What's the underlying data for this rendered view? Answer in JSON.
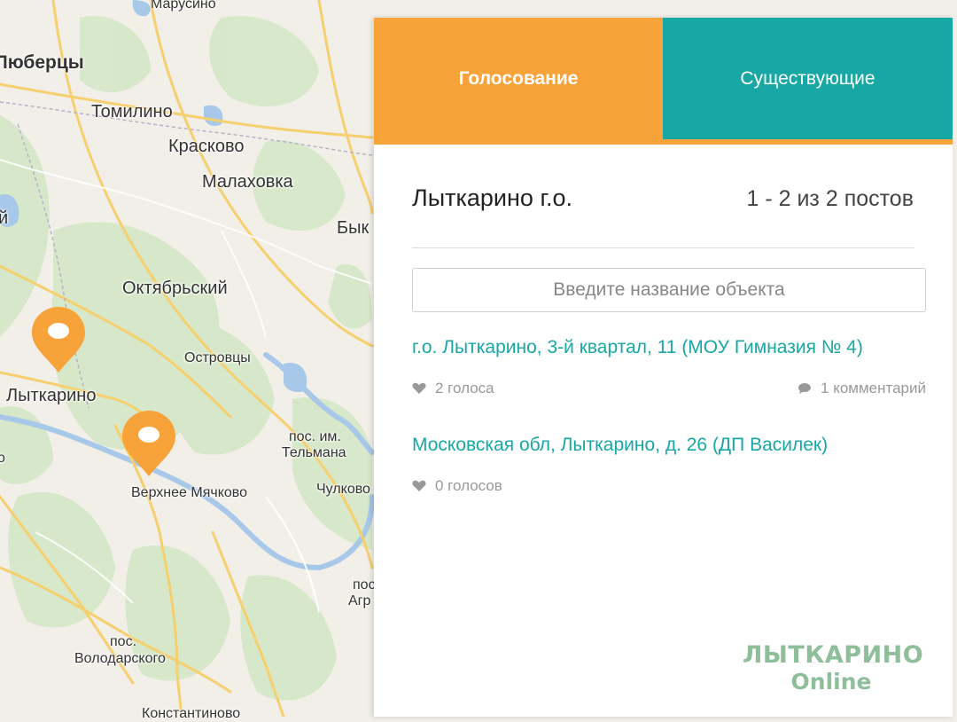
{
  "map": {
    "labels": {
      "lyubertsy": "Люберцы",
      "marusino": "Марусино",
      "tomilino": "Томилино",
      "kraskovo": "Красково",
      "malakhovka": "Малаховка",
      "byk": "Бык",
      "oktyabrsky": "Октябрьский",
      "ostrovtsy": "Островцы",
      "lytkarino": "Лыткарино",
      "pos_telmana_1": "пос. им.",
      "pos_telmana_2": "Тельмана",
      "chulkovo": "Чулково",
      "verkhnee_myachkovo": "Верхнее Мячково",
      "pos_agr_1": "пос",
      "pos_agr_2": "Агр",
      "pos_volodarskogo_1": "пос.",
      "pos_volodarskogo_2": "Володарского",
      "konstantinovo": "Константиново",
      "edge_o": "о",
      "edge_y": "й"
    },
    "pin_color": "#f8a23a",
    "pin_icon": "map-marker-icon"
  },
  "tabs": [
    {
      "label": "Голосование",
      "active": true,
      "color": "#f8a23a"
    },
    {
      "label": "Существующие",
      "active": false,
      "color": "#17a8a6"
    }
  ],
  "panel": {
    "title": "Лыткарино г.о.",
    "count": "1 - 2 из 2 постов",
    "search_placeholder": "Введите название объекта"
  },
  "posts": [
    {
      "title": "г.о. Лыткарино, 3-й квартал, 11 (МОУ Гимназия № 4)",
      "votes": "2 голоса",
      "comments": "1 комментарий"
    },
    {
      "title": "Московская обл, Лыткарино, д. 26 (ДП Василек)",
      "votes": "0 голосов"
    }
  ],
  "logo": {
    "line1": "ЛЫТКАРИНО",
    "line2": "Online"
  },
  "colors": {
    "accent_orange": "#f8a23a",
    "accent_teal": "#17a8a6",
    "logo_green": "#8fbe9a"
  }
}
